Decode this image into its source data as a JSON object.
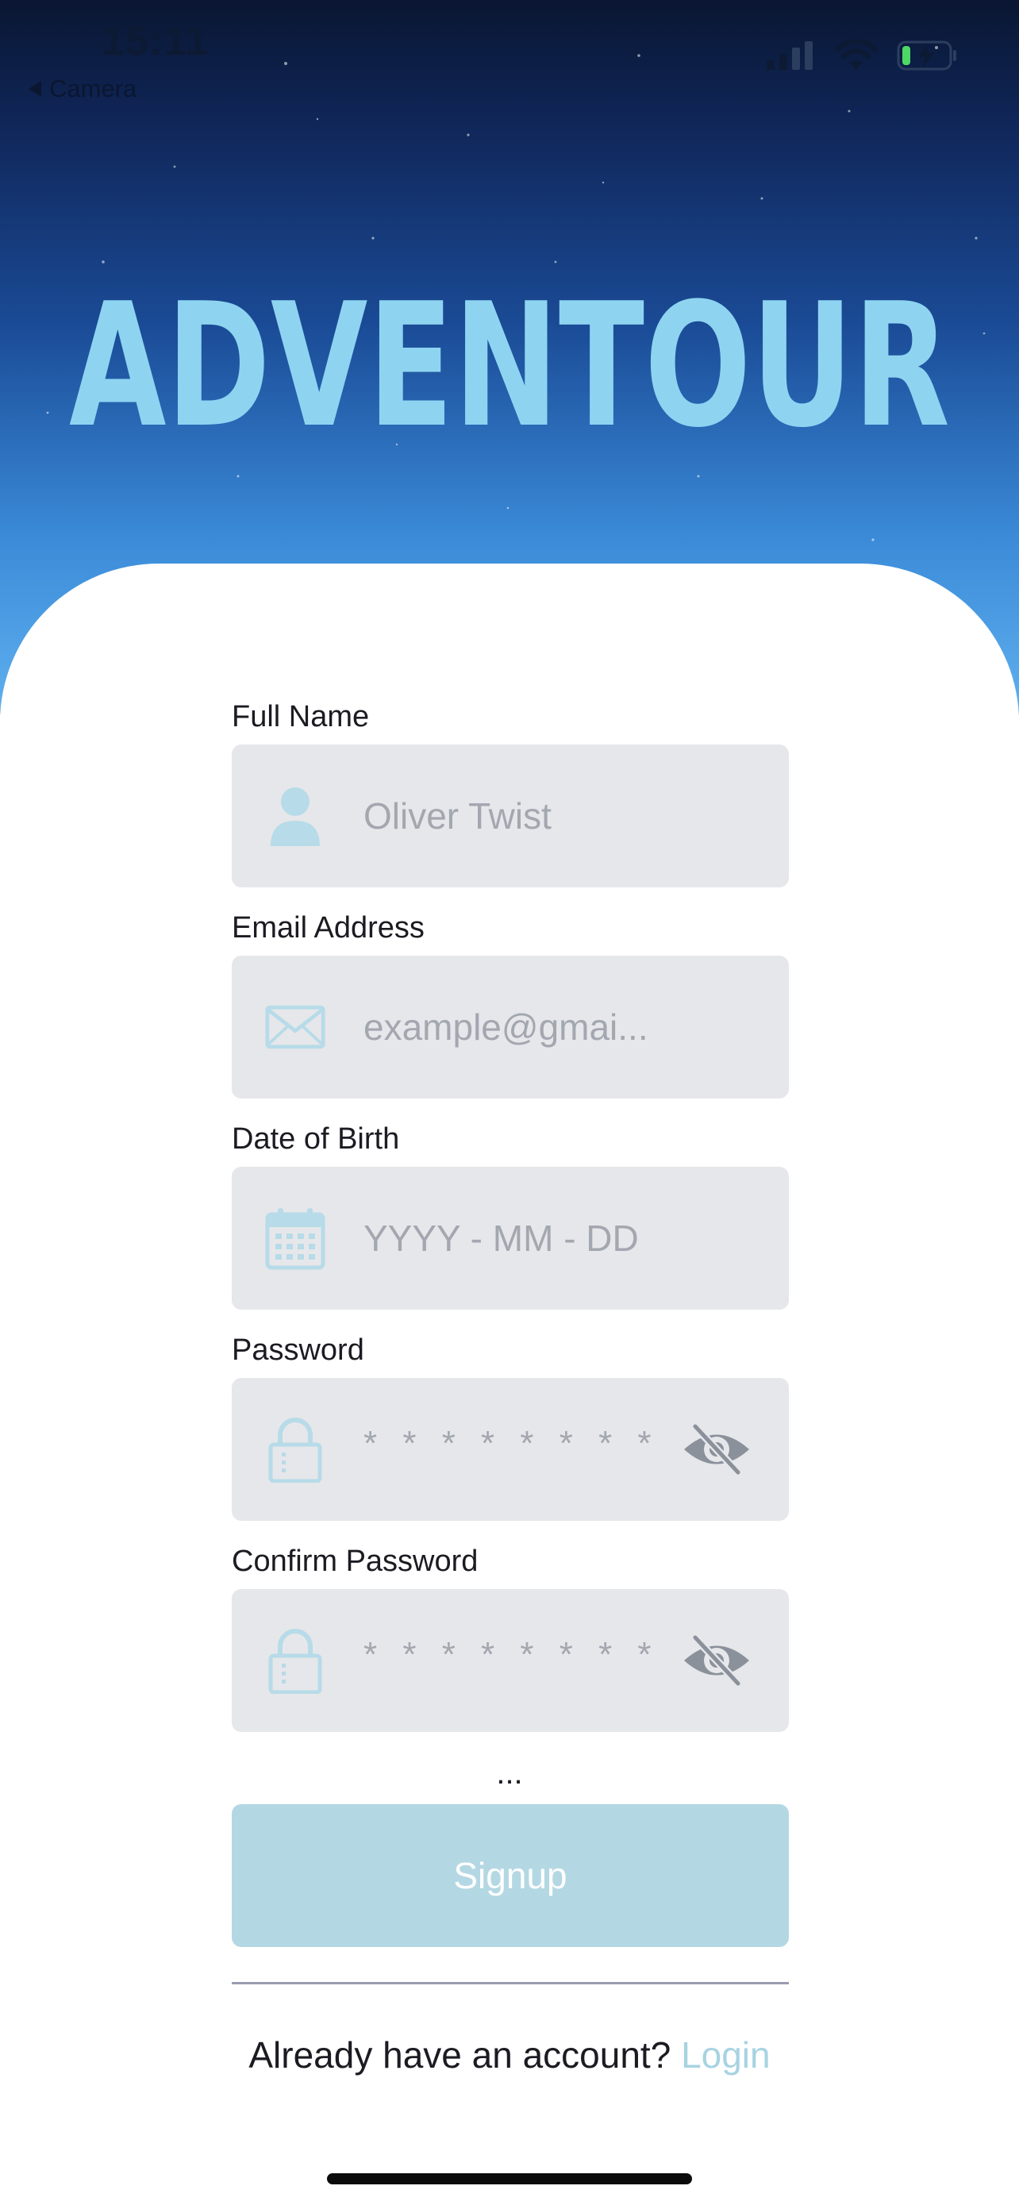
{
  "status_bar": {
    "time": "15:11",
    "back_label": "Camera"
  },
  "app": {
    "logo_text": "ADVENTOUR"
  },
  "form": {
    "full_name": {
      "label": "Full Name",
      "placeholder": "Oliver Twist",
      "icon": "person-icon"
    },
    "email": {
      "label": "Email Address",
      "placeholder": "example@gmai...",
      "icon": "envelope-icon"
    },
    "dob": {
      "label": "Date of Birth",
      "placeholder": "YYYY - MM - DD",
      "icon": "calendar-icon"
    },
    "password": {
      "label": "Password",
      "placeholder": "* * * * * * * *",
      "icon": "lock-icon",
      "toggle_icon": "eye-slash-icon"
    },
    "confirm_password": {
      "label": "Confirm Password",
      "placeholder": "* * * * * * * *",
      "icon": "lock-icon",
      "toggle_icon": "eye-slash-icon"
    },
    "ellipsis": "...",
    "signup_label": "Signup"
  },
  "footer": {
    "prompt": "Already have an account?",
    "login_label": "Login"
  },
  "colors": {
    "accent": "#a7d3e2",
    "button": "#b4d8e3",
    "field_bg": "#e6e7ea",
    "text": "#1b1b22",
    "placeholder": "#a3a7b0"
  }
}
